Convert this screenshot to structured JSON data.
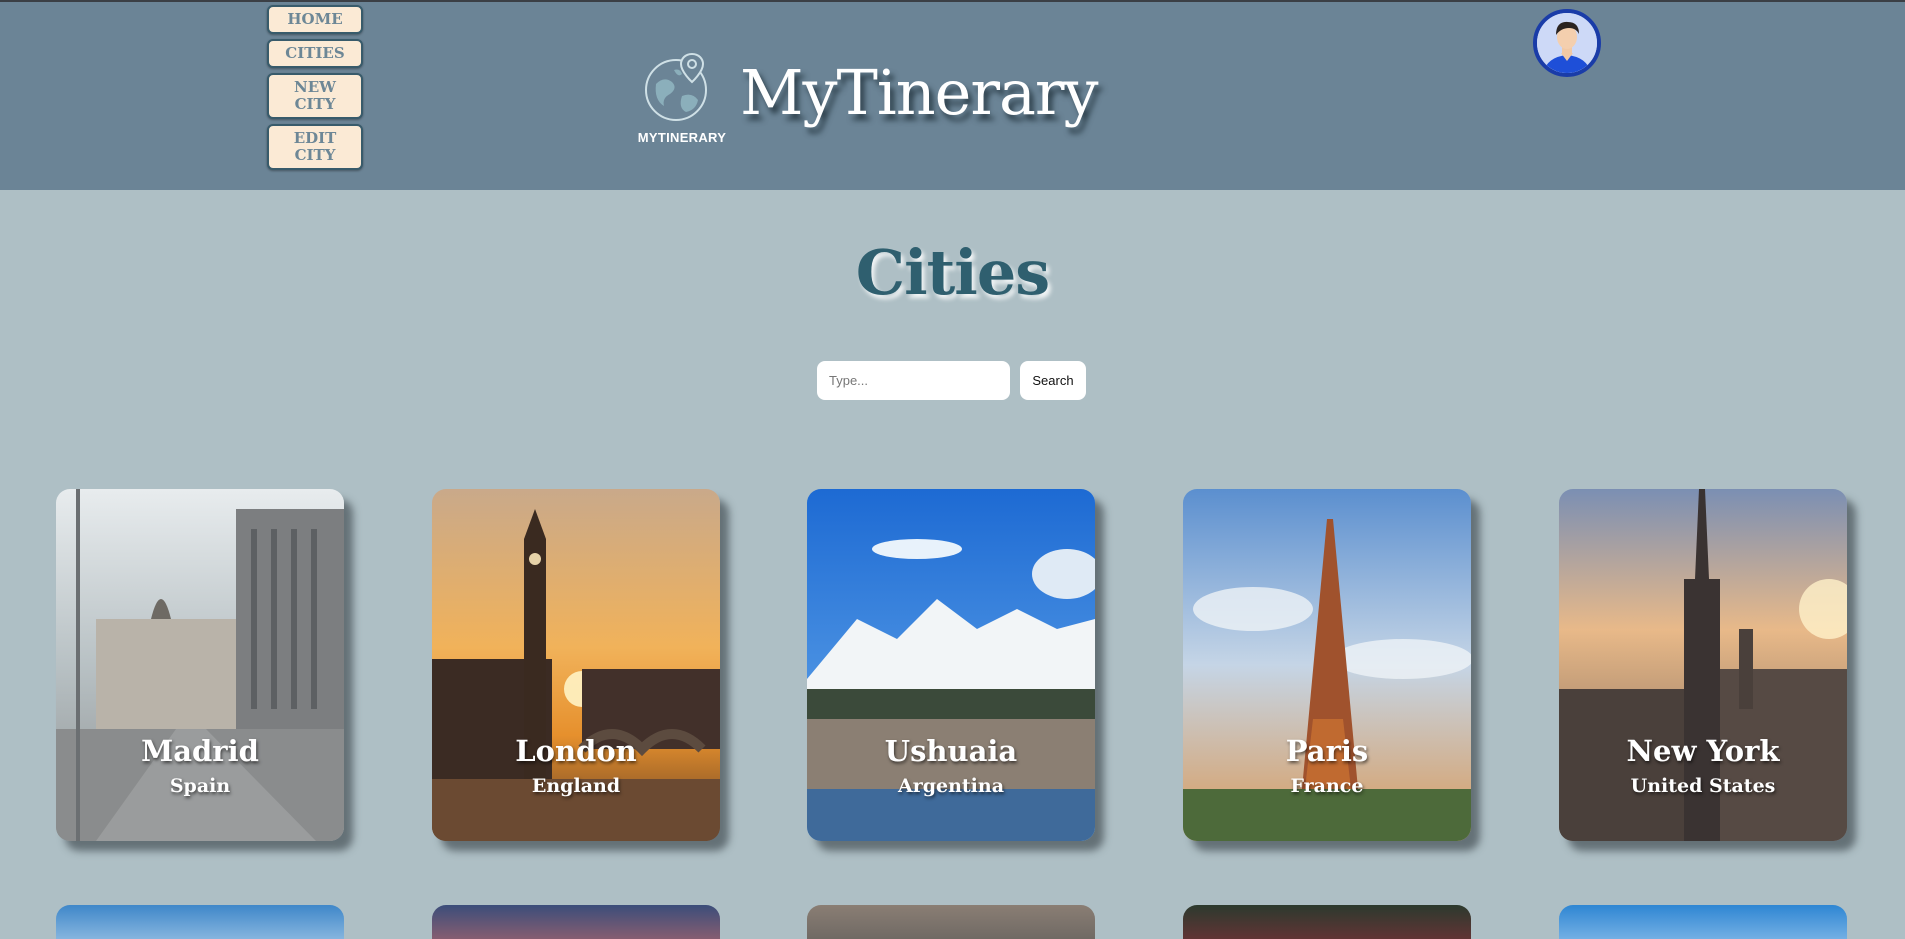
{
  "nav": {
    "items": [
      {
        "label": "HOME"
      },
      {
        "label": "CITIES"
      },
      {
        "label": "NEW\nCITY"
      },
      {
        "label": "EDIT\nCITY"
      }
    ]
  },
  "header": {
    "logo_text": "MYTINERARY",
    "brand_title": "MyTinerary",
    "avatar": "user-avatar-icon"
  },
  "main": {
    "title": "Cities",
    "search": {
      "placeholder": "Type...",
      "value": "",
      "button_label": "Search"
    },
    "cities": [
      {
        "name": "Madrid",
        "country": "Spain"
      },
      {
        "name": "London",
        "country": "England"
      },
      {
        "name": "Ushuaia",
        "country": "Argentina"
      },
      {
        "name": "Paris",
        "country": "France"
      },
      {
        "name": "New York",
        "country": "United States"
      }
    ]
  },
  "colors": {
    "header_bg": "#6b8496",
    "page_bg": "#aebfc5",
    "nav_button_bg": "#fbead5",
    "title_color": "#2f5f6f"
  }
}
